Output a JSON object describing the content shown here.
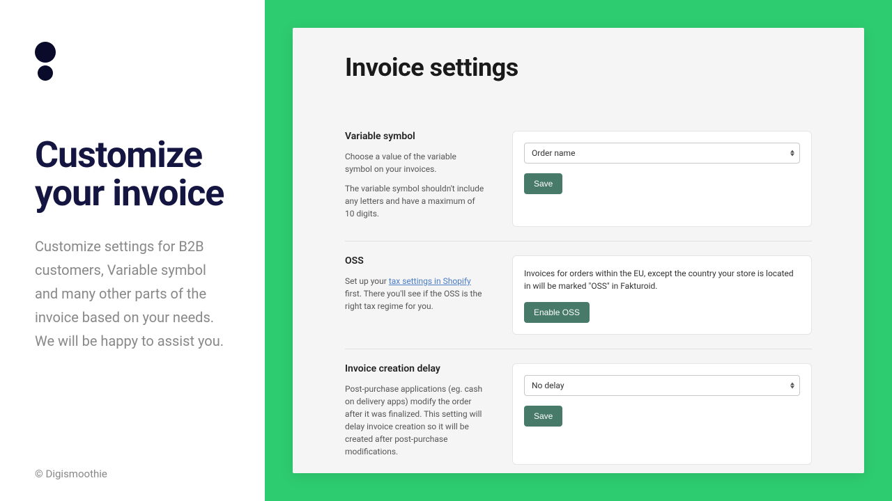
{
  "left": {
    "title": "Customize your invoice",
    "body": "Customize settings for B2B customers, Variable symbol and many other parts of the invoice based on your needs. We will be happy to assist you.",
    "copyright": "© Digismoothie"
  },
  "app": {
    "page_title": "Invoice settings",
    "sections": {
      "variable_symbol": {
        "title": "Variable symbol",
        "desc1": "Choose a value of the variable symbol on your invoices.",
        "desc2": "The variable symbol shouldn't include any letters and have a maximum of 10 digits.",
        "select_value": "Order name",
        "save_label": "Save"
      },
      "oss": {
        "title": "OSS",
        "desc_pre": "Set up your ",
        "link_label": "tax settings in Shopify",
        "desc_post": " first. There you'll see if the OSS is the right tax regime for you.",
        "card_text": "Invoices for orders within the EU, except the country your store is located in will be marked \"OSS\" in Fakturoid.",
        "button_label": "Enable OSS"
      },
      "delay": {
        "title": "Invoice creation delay",
        "desc": "Post-purchase applications (eg. cash on delivery apps) modify the order after it was finalized. This setting will delay invoice creation so it will be created after post-purchase modifications.",
        "select_value": "No delay",
        "save_label": "Save"
      }
    }
  },
  "colors": {
    "accent_green": "#2ecc71",
    "button_green": "#477a69",
    "dark": "#0a0420"
  }
}
